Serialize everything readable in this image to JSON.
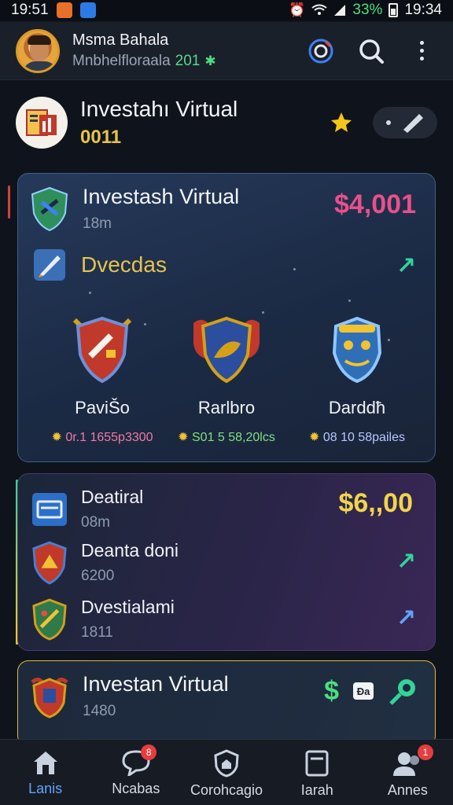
{
  "status_bar": {
    "time_left": "19:51",
    "battery_pct": "33%",
    "time_right": "19:34"
  },
  "header": {
    "user_name": "Msma Bahala",
    "user_sub": "Mnbhelfloraala",
    "user_sub_num": "201"
  },
  "account": {
    "title": "Investahı Virtual",
    "code": "0011"
  },
  "card_main": {
    "title": "Investash Virtual",
    "sub": "18m",
    "amount": "$4,001",
    "section_title": "Dvecdas",
    "badges": [
      {
        "name": "PaviŠo",
        "stat": "0r.1 1655p3300",
        "icon": "red-shield-icon"
      },
      {
        "name": "Rarlbro",
        "stat": "S01 5 58,20lcs",
        "icon": "blue-shield-icon"
      },
      {
        "name": "Darddħ",
        "stat": "08 10 58pailes",
        "icon": "mask-icon"
      }
    ]
  },
  "card_list": {
    "amount": "$6,,00",
    "items": [
      {
        "title": "Deatiral",
        "sub": "08m"
      },
      {
        "title": "Deanta doni",
        "sub": "6200"
      },
      {
        "title": "Dvestialami",
        "sub": "1811"
      }
    ]
  },
  "card_bottom": {
    "title": "Investan Virtual",
    "sub": "1480",
    "chip": "Đa"
  },
  "nav": {
    "items": [
      {
        "label": "Lanis",
        "icon": "home-icon"
      },
      {
        "label": "Ncabas",
        "icon": "chat-icon",
        "badge": "8"
      },
      {
        "label": "Corohcagio",
        "icon": "shield-home-icon"
      },
      {
        "label": "Iarah",
        "icon": "document-icon"
      },
      {
        "label": "Annes",
        "icon": "people-icon",
        "badge": "1"
      }
    ]
  },
  "colors": {
    "accent_blue": "#3b82f6",
    "amount_pink": "#e9508a",
    "amount_yellow": "#f1d54a",
    "trend_green": "#34d399"
  }
}
